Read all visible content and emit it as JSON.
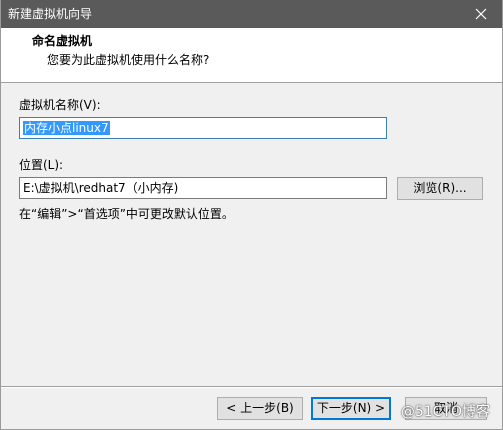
{
  "window": {
    "title": "新建虚拟机向导"
  },
  "header": {
    "title": "命名虚拟机",
    "subtitle": "您要为此虚拟机使用什么名称?"
  },
  "form": {
    "name_label": "虚拟机名称(V):",
    "name_value": "内存小点linux7",
    "location_label": "位置(L):",
    "location_value": "E:\\虚拟机\\redhat7（小内存)",
    "browse_label": "浏览(R)...",
    "hint": "在“编辑”>“首选项”中可更改默认位置。"
  },
  "footer": {
    "back_label": "< 上一步(B)",
    "next_label": "下一步(N) >",
    "cancel_label": "取消"
  },
  "watermark": "@51CTO博客",
  "colors": {
    "titlebar": "#5a5a5a",
    "selection": "#3399ff",
    "default_button_border": "#0078d7",
    "panel_bg": "#f0f0f0"
  }
}
